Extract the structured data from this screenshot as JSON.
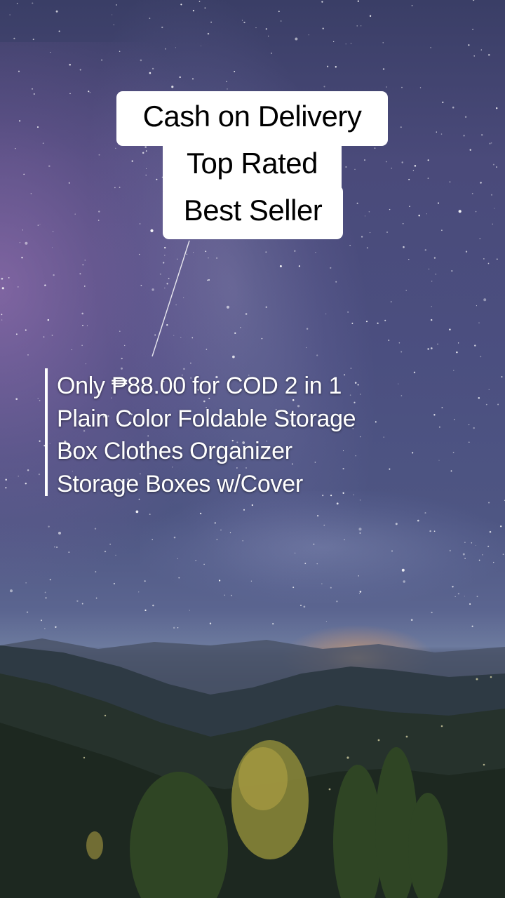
{
  "badges": {
    "line1": "Cash on Delivery",
    "line2": "Top Rated",
    "line3": "Best Seller"
  },
  "caption": {
    "lines": [
      "Only ₱88.00 for COD 2 in 1",
      "Plain Color Foldable Storage",
      "Box Clothes Organizer",
      "Storage Boxes w/Cover"
    ]
  },
  "colors": {
    "badge_bg": "#ffffff",
    "badge_text": "#000000",
    "caption_text": "#ffffff",
    "sky_top": "#3a3e66",
    "horizon_glow": "#ffbe6e"
  }
}
